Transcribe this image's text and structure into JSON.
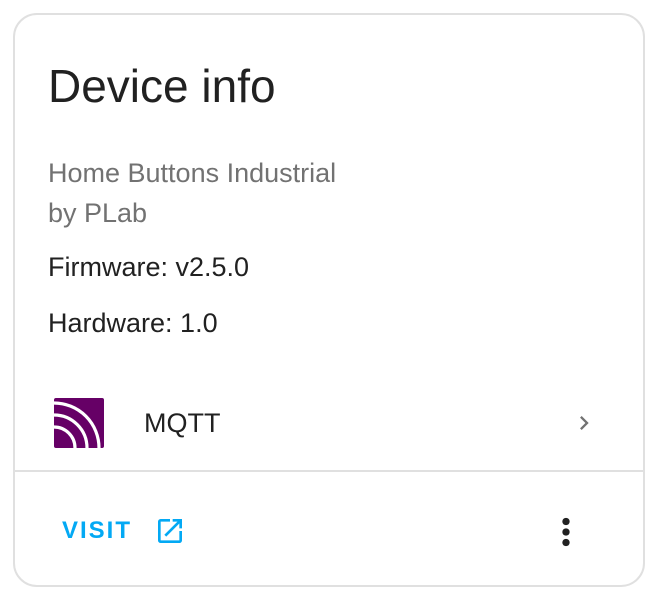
{
  "card": {
    "title": "Device info",
    "model_line1": "Home Buttons Industrial",
    "model_line2": "by PLab",
    "firmware": "Firmware: v2.5.0",
    "hardware": "Hardware: 1.0"
  },
  "integration": {
    "label": "MQTT",
    "logo_icon": "mqtt-logo-icon",
    "logo_color": "#660066",
    "chevron_icon": "chevron-right-icon"
  },
  "actions": {
    "visit_label": "VISIT",
    "visit_icon": "open-in-new-icon",
    "more_icon": "more-vertical-icon",
    "accent_color": "#03a9f4"
  }
}
